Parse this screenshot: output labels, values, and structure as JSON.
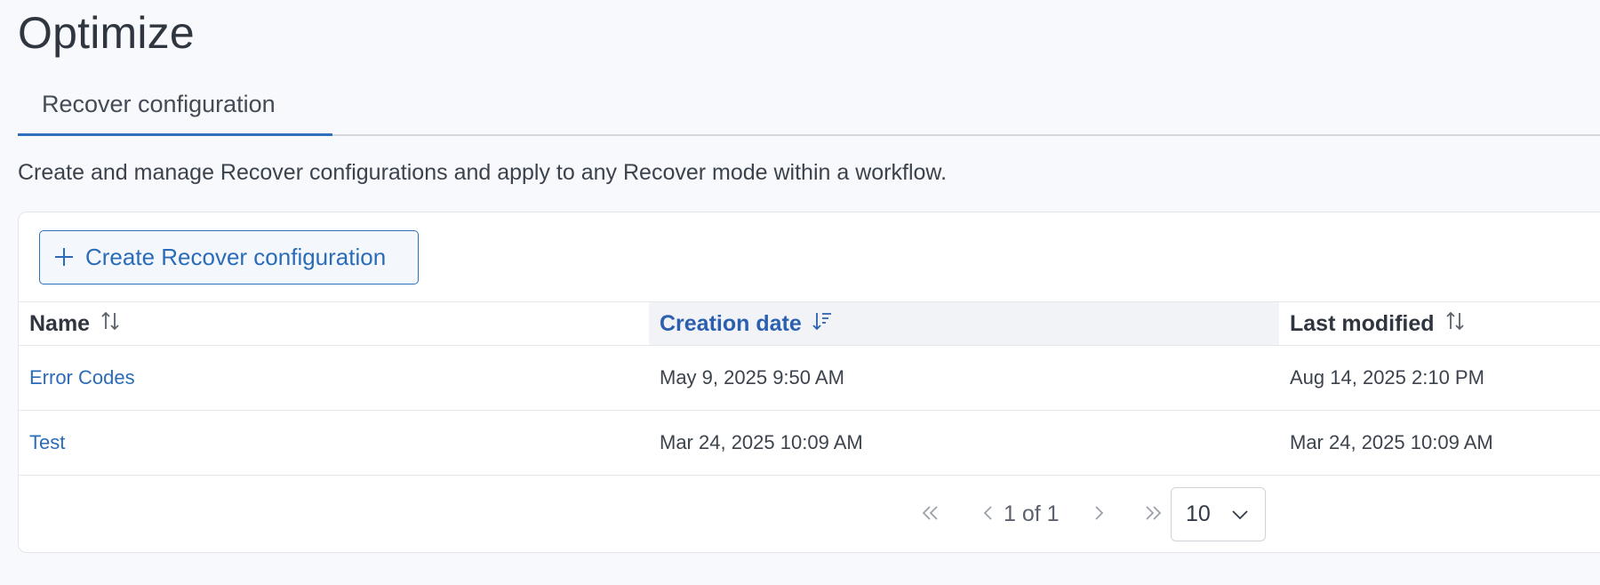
{
  "page": {
    "title": "Optimize"
  },
  "tabs": [
    {
      "label": "Recover configuration"
    }
  ],
  "description": "Create and manage Recover configurations and apply to any Recover mode within a workflow.",
  "toolbar": {
    "create_label": "Create Recover configuration",
    "create_icon": "plus-icon"
  },
  "table": {
    "columns": [
      {
        "label": "Name",
        "sort_icon": "sort-both-icon"
      },
      {
        "label": "Creation date",
        "sort_icon": "sort-descending-icon",
        "sorted": true
      },
      {
        "label": "Last modified",
        "sort_icon": "sort-both-icon"
      }
    ],
    "rows": [
      {
        "name": "Error Codes",
        "created": "May 9, 2025 9:50 AM",
        "modified": "Aug 14, 2025 2:10 PM"
      },
      {
        "name": "Test",
        "created": "Mar 24, 2025 10:09 AM",
        "modified": "Mar 24, 2025 10:09 AM"
      }
    ]
  },
  "pagination": {
    "page_text": "1 of 1",
    "page_size": "10",
    "icons": [
      "first-page-icon",
      "prev-page-icon",
      "next-page-icon",
      "last-page-icon",
      "chevron-down-icon"
    ]
  },
  "colors": {
    "accent": "#2f6fbc",
    "link": "#2b6cb8",
    "background": "#f7f9fd"
  }
}
